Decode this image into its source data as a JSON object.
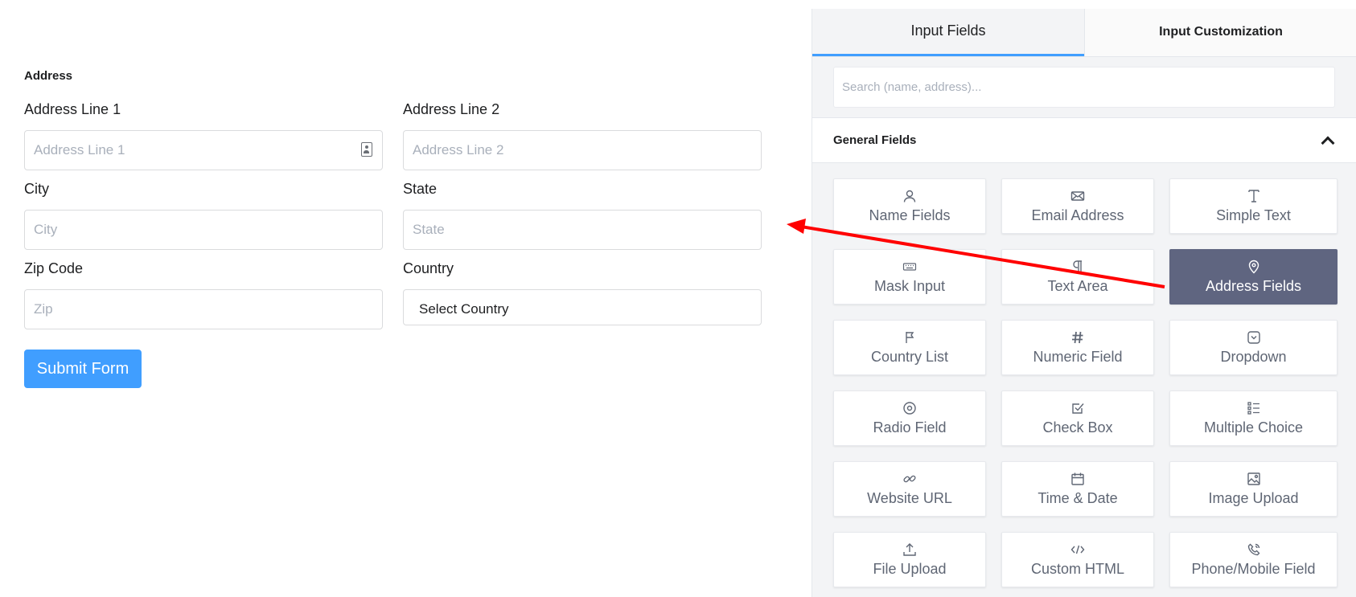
{
  "form": {
    "section_title": "Address",
    "fields": {
      "address_line_1": {
        "label": "Address Line 1",
        "placeholder": "Address Line 1"
      },
      "address_line_2": {
        "label": "Address Line 2",
        "placeholder": "Address Line 2"
      },
      "city": {
        "label": "City",
        "placeholder": "City"
      },
      "state": {
        "label": "State",
        "placeholder": "State"
      },
      "zip": {
        "label": "Zip Code",
        "placeholder": "Zip"
      },
      "country": {
        "label": "Country",
        "selected": "Select Country"
      }
    },
    "submit_label": "Submit Form"
  },
  "sidebar": {
    "tabs": [
      {
        "label": "Input Fields",
        "active": true
      },
      {
        "label": "Input Customization",
        "active": false
      }
    ],
    "search_placeholder": "Search (name, address)...",
    "group": {
      "title": "General Fields",
      "expanded": true,
      "items": [
        {
          "label": "Name Fields",
          "icon": "user-icon"
        },
        {
          "label": "Email Address",
          "icon": "envelope-icon"
        },
        {
          "label": "Simple Text",
          "icon": "text-cursor-icon"
        },
        {
          "label": "Mask Input",
          "icon": "keyboard-icon"
        },
        {
          "label": "Text Area",
          "icon": "paragraph-icon"
        },
        {
          "label": "Address Fields",
          "icon": "map-pin-icon",
          "selected": true
        },
        {
          "label": "Country List",
          "icon": "flag-icon"
        },
        {
          "label": "Numeric Field",
          "icon": "hash-icon"
        },
        {
          "label": "Dropdown",
          "icon": "dropdown-icon"
        },
        {
          "label": "Radio Field",
          "icon": "radio-icon"
        },
        {
          "label": "Check Box",
          "icon": "checkbox-icon"
        },
        {
          "label": "Multiple Choice",
          "icon": "list-icon"
        },
        {
          "label": "Website URL",
          "icon": "link-icon"
        },
        {
          "label": "Time & Date",
          "icon": "calendar-icon"
        },
        {
          "label": "Image Upload",
          "icon": "image-icon"
        },
        {
          "label": "File Upload",
          "icon": "upload-icon"
        },
        {
          "label": "Custom HTML",
          "icon": "code-icon"
        },
        {
          "label": "Phone/Mobile Field",
          "icon": "phone-icon"
        }
      ]
    }
  },
  "colors": {
    "accent": "#409eff",
    "selected_card": "#5f6580",
    "annotation_arrow": "#ff0000"
  }
}
